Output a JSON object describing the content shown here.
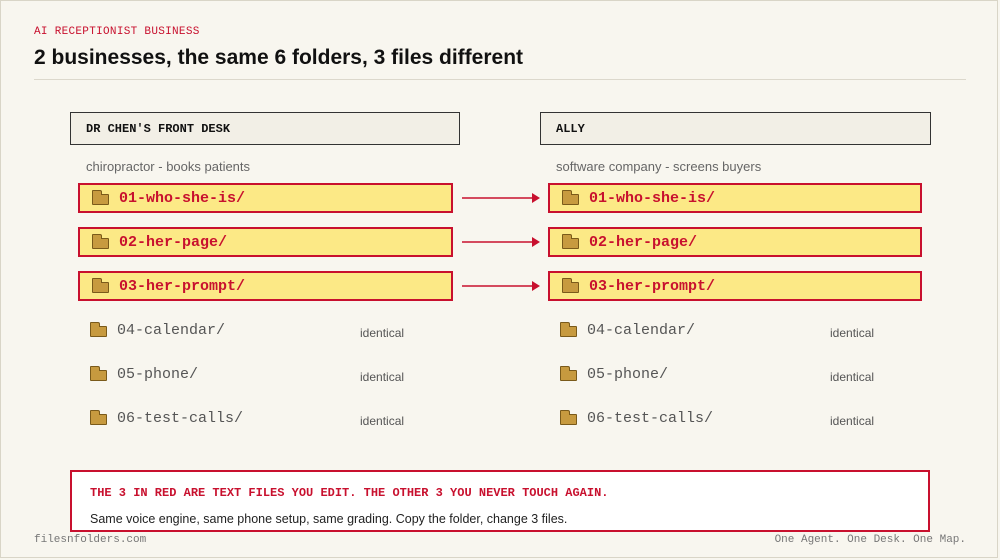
{
  "eyebrow": "AI RECEPTIONIST BUSINESS",
  "title": "2 businesses, the same 6 folders, 3 files different",
  "left": {
    "header": "DR CHEN'S FRONT DESK",
    "subtitle": "chiropractor  -  books patients"
  },
  "right": {
    "header": "ALLY",
    "subtitle": "software company  -  screens buyers"
  },
  "folders": {
    "changed": [
      "01-who-she-is/",
      "02-her-page/",
      "03-her-prompt/"
    ],
    "same": [
      "04-calendar/",
      "05-phone/",
      "06-test-calls/"
    ]
  },
  "identical_label": "identical",
  "icons": {
    "folder": "folder-icon",
    "arrow": "arrow-right-icon"
  },
  "colors": {
    "accent": "#c8102e",
    "highlight": "#fce986",
    "folder": "#c79a3f"
  },
  "note": {
    "heading": "THE 3 IN RED ARE TEXT FILES YOU EDIT. THE OTHER 3 YOU NEVER TOUCH AGAIN.",
    "body": "Same voice engine, same phone setup, same grading. Copy the folder, change 3 files."
  },
  "footer": {
    "left": "filesnfolders.com",
    "right": "One Agent. One Desk. One Map."
  }
}
